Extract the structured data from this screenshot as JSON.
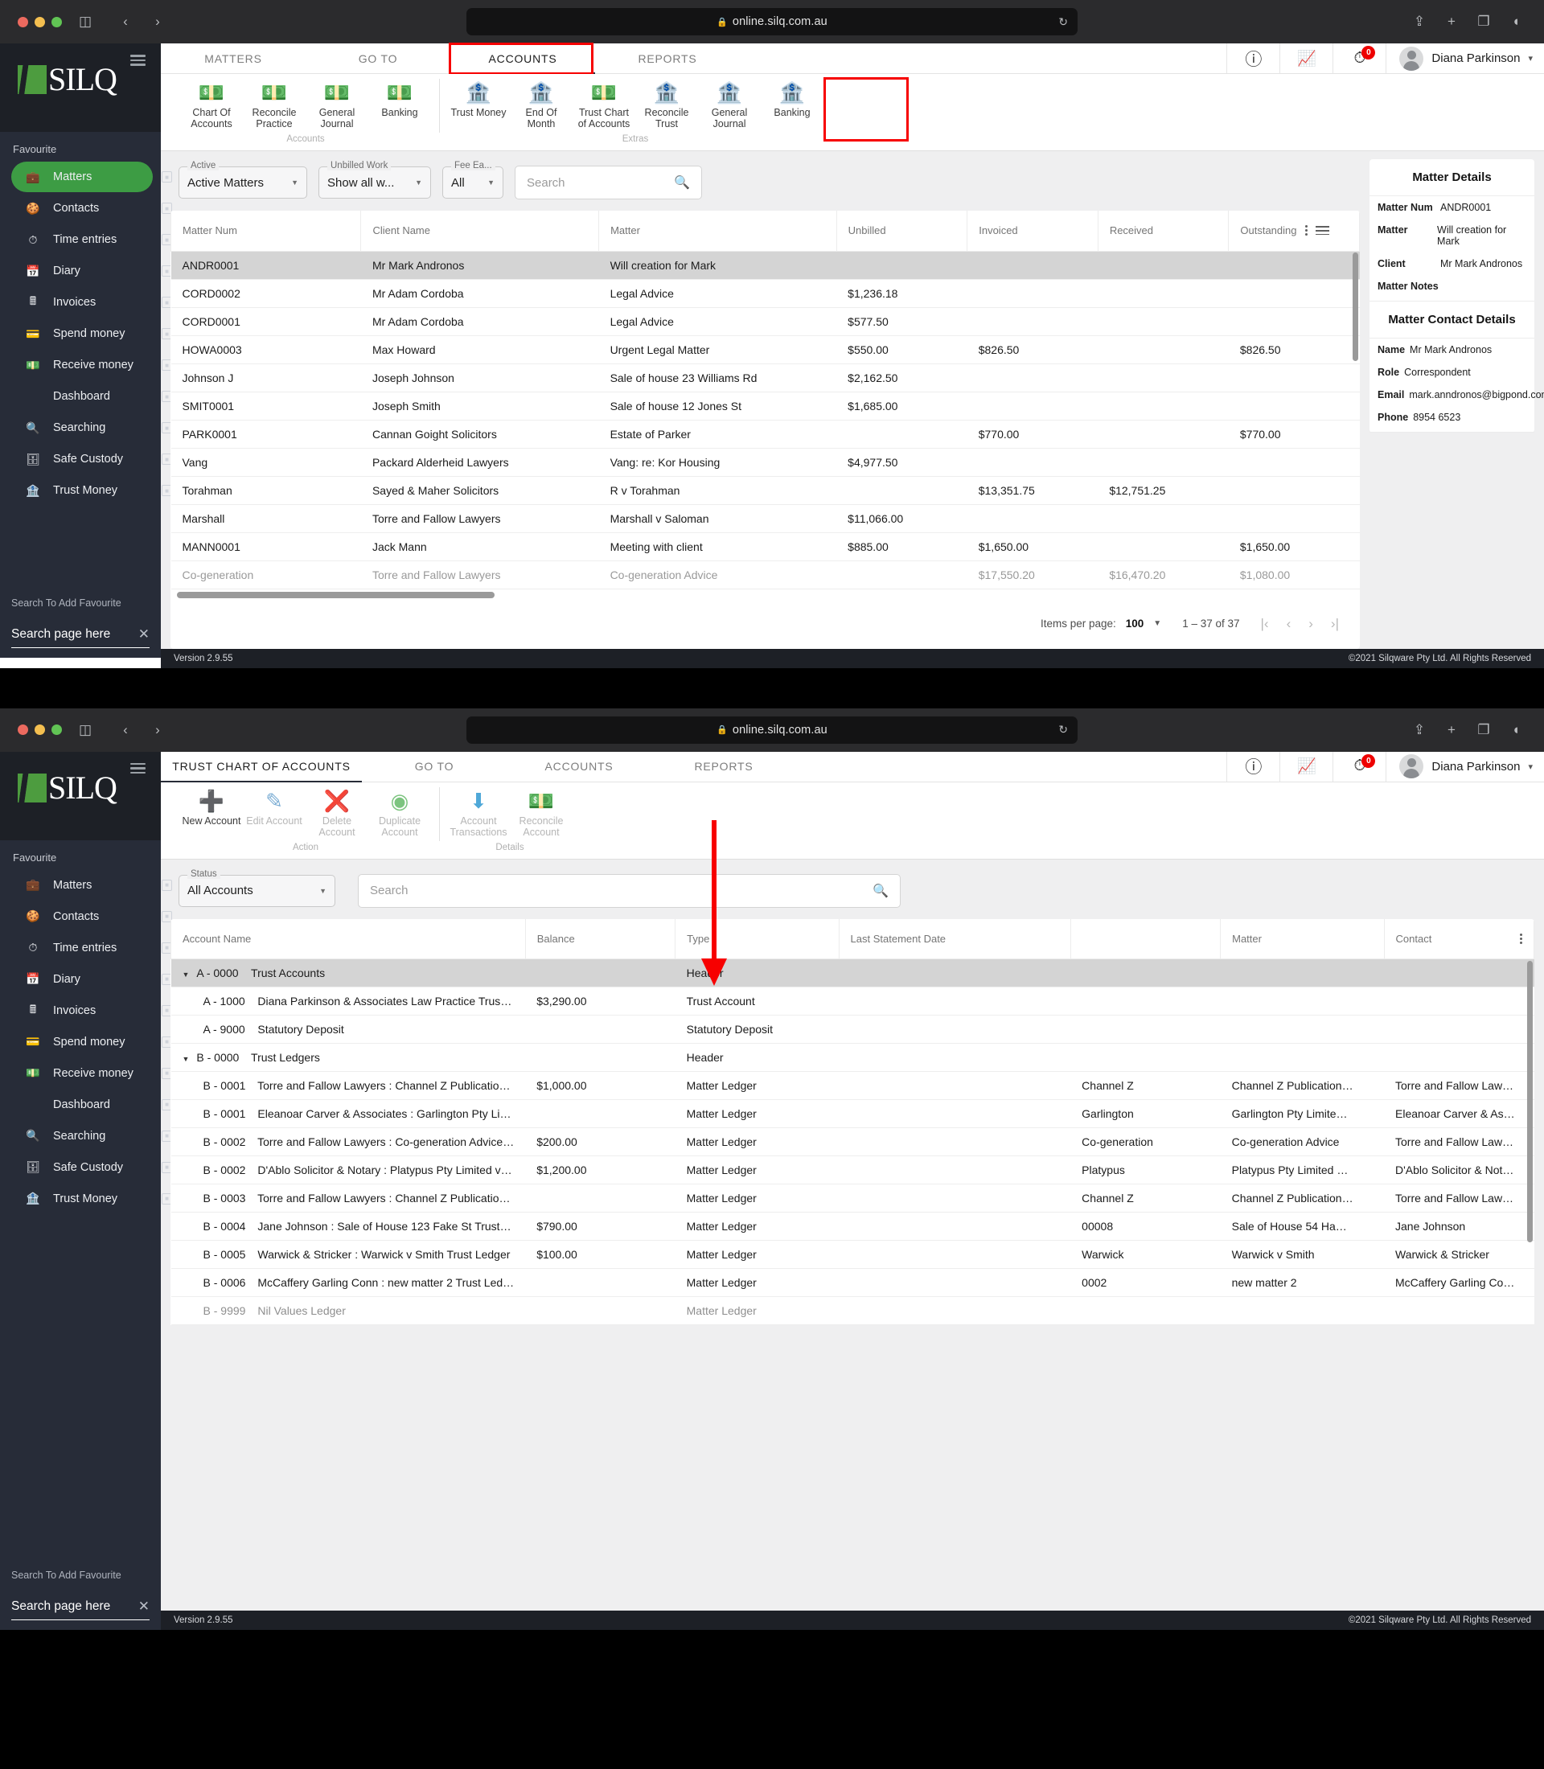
{
  "browser": {
    "url": "online.silq.com.au",
    "lock_icon": "lock-icon",
    "reload_icon": "reload-icon",
    "share_icon": "share-icon",
    "newtab_icon": "plus-icon",
    "tabs_icon": "copy-tabs-icon",
    "sidebar_icon": "sidebar-toggle-icon",
    "back_icon": "back-chevron-icon",
    "forward_icon": "forward-chevron-icon",
    "contrast_icon": "contrast-icon"
  },
  "sidebar": {
    "logo_text": "SILQ",
    "favourite_label": "Favourite",
    "items": [
      {
        "label": "Matters",
        "icon": "briefcase-icon",
        "active": true
      },
      {
        "label": "Contacts",
        "icon": "contacts-icon",
        "active": false
      },
      {
        "label": "Time entries",
        "icon": "stopwatch-icon",
        "active": false
      },
      {
        "label": "Diary",
        "icon": "calendar-icon",
        "active": false
      },
      {
        "label": "Invoices",
        "icon": "calculator-icon",
        "active": false
      },
      {
        "label": "Spend money",
        "icon": "cheque-icon",
        "active": false
      },
      {
        "label": "Receive money",
        "icon": "cash-icon",
        "active": false
      },
      {
        "label": "Dashboard",
        "icon": "",
        "active": false
      },
      {
        "label": "Searching",
        "icon": "magnifier-icon",
        "active": false
      },
      {
        "label": "Safe Custody",
        "icon": "safe-icon",
        "active": false
      },
      {
        "label": "Trust Money",
        "icon": "bank-icon",
        "active": false
      }
    ],
    "add_favourite": "Search To Add Favourite",
    "search_value": "Search page here",
    "clear_icon": "close-icon"
  },
  "topbar": {
    "help_icon": "help-circle-icon",
    "chart_icon": "chart-trend-icon",
    "timer_icon": "stopwatch-icon",
    "timer_badge": "0",
    "avatar_icon": "avatar-icon",
    "user_name": "Diana Parkinson",
    "caret_icon": "chevron-down-icon"
  },
  "highlight_color": "#f70000",
  "window1": {
    "tabs": [
      {
        "label": "MATTERS",
        "active": false,
        "highlighted": false
      },
      {
        "label": "GO TO",
        "active": false,
        "highlighted": false
      },
      {
        "label": "ACCOUNTS",
        "active": true,
        "highlighted": true
      },
      {
        "label": "REPORTS",
        "active": false,
        "highlighted": false
      }
    ],
    "ribbon_groups": [
      {
        "name": "Accounts",
        "items": [
          {
            "label": "Chart Of Accounts",
            "icon": "money-stack-icon",
            "highlighted": false
          },
          {
            "label": "Reconcile Practice",
            "icon": "money-stack-icon",
            "highlighted": false
          },
          {
            "label": "General Journal",
            "icon": "money-stack-icon",
            "highlighted": false
          },
          {
            "label": "Banking",
            "icon": "money-stack-icon",
            "highlighted": false
          }
        ]
      },
      {
        "name": "Extras",
        "items": [
          {
            "label": "Trust Money",
            "icon": "bank-icon",
            "highlighted": false
          },
          {
            "label": "End Of Month",
            "icon": "bank-icon",
            "highlighted": false
          },
          {
            "label": "Trust Chart of Accounts",
            "icon": "money-stack-icon",
            "highlighted": true
          },
          {
            "label": "Reconcile Trust",
            "icon": "bank-icon",
            "highlighted": false
          },
          {
            "label": "General Journal",
            "icon": "bank-icon",
            "highlighted": false
          },
          {
            "label": "Banking",
            "icon": "bank-icon",
            "highlighted": false
          }
        ]
      }
    ],
    "filters": [
      {
        "label": "Active",
        "value": "Active Matters",
        "width": 160
      },
      {
        "label": "Unbilled Work",
        "value": "Show all w...",
        "width": 128
      },
      {
        "label": "Fee Ea...",
        "value": "All",
        "width": 72
      }
    ],
    "search_placeholder": "Search",
    "search_icon": "magnifier-icon",
    "columns": [
      "Matter Num",
      "Client Name",
      "Matter",
      "Unbilled",
      "Invoiced",
      "Received",
      "Outstanding"
    ],
    "rows": [
      {
        "cells": [
          "ANDR0001",
          "Mr Mark Andronos",
          "Will creation for Mark",
          "",
          "",
          "",
          ""
        ],
        "selected": true
      },
      {
        "cells": [
          "CORD0002",
          "Mr Adam Cordoba",
          "Legal Advice",
          "$1,236.18",
          "",
          "",
          ""
        ],
        "selected": false
      },
      {
        "cells": [
          "CORD0001",
          "Mr Adam Cordoba",
          "Legal Advice",
          "$577.50",
          "",
          "",
          ""
        ],
        "selected": false
      },
      {
        "cells": [
          "HOWA0003",
          "Max Howard",
          "Urgent Legal Matter",
          "$550.00",
          "$826.50",
          "",
          "$826.50"
        ],
        "selected": false
      },
      {
        "cells": [
          "Johnson J",
          "Joseph Johnson",
          "Sale of house 23 Williams Rd",
          "$2,162.50",
          "",
          "",
          ""
        ],
        "selected": false
      },
      {
        "cells": [
          "SMIT0001",
          "Joseph Smith",
          "Sale of house 12 Jones St",
          "$1,685.00",
          "",
          "",
          ""
        ],
        "selected": false
      },
      {
        "cells": [
          "PARK0001",
          "Cannan Goight Solicitors",
          "Estate of Parker",
          "",
          "$770.00",
          "",
          "$770.00"
        ],
        "selected": false
      },
      {
        "cells": [
          "Vang",
          "Packard Alderheid Lawyers",
          "Vang: re: Kor Housing",
          "$4,977.50",
          "",
          "",
          ""
        ],
        "selected": false
      },
      {
        "cells": [
          "Torahman",
          "Sayed & Maher Solicitors",
          "R v Torahman",
          "",
          "$13,351.75",
          "$12,751.25",
          ""
        ],
        "selected": false
      },
      {
        "cells": [
          "Marshall",
          "Torre and Fallow Lawyers",
          "Marshall v Saloman",
          "$11,066.00",
          "",
          "",
          ""
        ],
        "selected": false
      },
      {
        "cells": [
          "MANN0001",
          "Jack Mann",
          "Meeting with client",
          "$885.00",
          "$1,650.00",
          "",
          "$1,650.00"
        ],
        "selected": false
      },
      {
        "cells": [
          "Co-generation",
          "Torre and Fallow Lawyers",
          "Co-generation Advice",
          "",
          "$17,550.20",
          "$16,470.20",
          "$1,080.00"
        ],
        "selected": false
      }
    ],
    "paginator": {
      "items_per_page_label": "Items per page:",
      "items_per_page_value": "100",
      "range_label": "1 – 37 of 37",
      "first_icon": "first-page-icon",
      "prev_icon": "prev-page-icon",
      "next_icon": "next-page-icon",
      "last_icon": "last-page-icon"
    },
    "details": {
      "title": "Matter Details",
      "rows": [
        {
          "key": "Matter Num",
          "value": "ANDR0001"
        },
        {
          "key": "Matter",
          "value": "Will creation for Mark"
        },
        {
          "key": "Client",
          "value": "Mr Mark Andronos"
        },
        {
          "key": "Matter Notes",
          "value": ""
        }
      ],
      "contact_title": "Matter Contact Details",
      "contact_rows": [
        {
          "key": "Name",
          "value": "Mr Mark Andronos"
        },
        {
          "key": "Role",
          "value": "Correspondent"
        },
        {
          "key": "Email",
          "value": "mark.anndronos@bigpond.com"
        },
        {
          "key": "Phone",
          "value": "8954 6523"
        }
      ]
    },
    "status": {
      "version": "Version 2.9.55",
      "copyright": "©2021 Silqware Pty Ltd. All Rights Reserved"
    }
  },
  "window2": {
    "tabs": [
      {
        "label": "TRUST CHART OF ACCOUNTS",
        "active": true,
        "highlighted": false
      },
      {
        "label": "GO TO",
        "active": false,
        "highlighted": false
      },
      {
        "label": "ACCOUNTS",
        "active": false,
        "highlighted": false
      },
      {
        "label": "REPORTS",
        "active": false,
        "highlighted": false
      }
    ],
    "ribbon_groups": [
      {
        "name": "Action",
        "items": [
          {
            "label": "New Account",
            "icon": "plus-circle-icon",
            "disabled": false
          },
          {
            "label": "Edit Account",
            "icon": "pencil-circle-icon",
            "disabled": true
          },
          {
            "label": "Delete Account",
            "icon": "delete-circle-icon",
            "disabled": true
          },
          {
            "label": "Duplicate Account",
            "icon": "duplicate-icon",
            "disabled": true
          }
        ]
      },
      {
        "name": "Details",
        "items": [
          {
            "label": "Account Transactions",
            "icon": "down-arrow-icon",
            "disabled": true
          },
          {
            "label": "Reconcile Account",
            "icon": "money-stack-icon",
            "disabled": true
          }
        ]
      }
    ],
    "filters": [
      {
        "label": "Status",
        "value": "All Accounts",
        "width": 195
      }
    ],
    "search_placeholder": "Search",
    "search_icon": "magnifier-icon",
    "columns": [
      "Account Name",
      "Balance",
      "Type",
      "Last Statement Date",
      "",
      "Matter",
      "Contact"
    ],
    "rows": [
      {
        "indent": 0,
        "expander": true,
        "code": "A - 0000",
        "name": "Trust Accounts",
        "balance": "",
        "type": "Header",
        "date": "",
        "blank": "",
        "matter": "",
        "contact": "",
        "selected": true
      },
      {
        "indent": 1,
        "expander": false,
        "code": "A - 1000",
        "name": "Diana Parkinson & Associates Law Practice Trust …",
        "balance": "$3,290.00",
        "type": "Trust Account",
        "date": "",
        "blank": "",
        "matter": "",
        "contact": "",
        "selected": false
      },
      {
        "indent": 1,
        "expander": false,
        "code": "A - 9000",
        "name": "Statutory Deposit",
        "balance": "",
        "type": "Statutory Deposit",
        "date": "",
        "blank": "",
        "matter": "",
        "contact": "",
        "selected": false
      },
      {
        "indent": 0,
        "expander": true,
        "code": "B - 0000",
        "name": "Trust Ledgers",
        "balance": "",
        "type": "Header",
        "date": "",
        "blank": "",
        "matter": "",
        "contact": "",
        "selected": false
      },
      {
        "indent": 1,
        "expander": false,
        "code": "B - 0001",
        "name": "Torre and Fallow Lawyers : Channel Z Publications…",
        "balance": "$1,000.00",
        "type": "Matter Ledger",
        "date": "",
        "blank": "Channel Z",
        "matter": "Channel Z Publication…",
        "contact": "Torre and Fallow Law…",
        "selected": false
      },
      {
        "indent": 1,
        "expander": false,
        "code": "B - 0001",
        "name": "Eleanoar Carver & Associates : Garlington Pty Limi…",
        "balance": "",
        "type": "Matter Ledger",
        "date": "",
        "blank": "Garlington",
        "matter": "Garlington Pty Limite…",
        "contact": "Eleanoar Carver & As…",
        "selected": false
      },
      {
        "indent": 1,
        "expander": false,
        "code": "B - 0002",
        "name": "Torre and Fallow Lawyers : Co-generation Advice …",
        "balance": "$200.00",
        "type": "Matter Ledger",
        "date": "",
        "blank": "Co-generation",
        "matter": "Co-generation Advice",
        "contact": "Torre and Fallow Law…",
        "selected": false
      },
      {
        "indent": 1,
        "expander": false,
        "code": "B - 0002",
        "name": "D'Ablo Solicitor & Notary : Platypus Pty Limited v …",
        "balance": "$1,200.00",
        "type": "Matter Ledger",
        "date": "",
        "blank": "Platypus",
        "matter": "Platypus Pty Limited …",
        "contact": "D'Ablo Solicitor & Not…",
        "selected": false
      },
      {
        "indent": 1,
        "expander": false,
        "code": "B - 0003",
        "name": "Torre and Fallow Lawyers : Channel Z Publications…",
        "balance": "",
        "type": "Matter Ledger",
        "date": "",
        "blank": "Channel Z",
        "matter": "Channel Z Publication…",
        "contact": "Torre and Fallow Law…",
        "selected": false
      },
      {
        "indent": 1,
        "expander": false,
        "code": "B - 0004",
        "name": "Jane Johnson : Sale of House 123 Fake St Trust L…",
        "balance": "$790.00",
        "type": "Matter Ledger",
        "date": "",
        "blank": "00008",
        "matter": "Sale of House 54 Ha…",
        "contact": "Jane Johnson",
        "selected": false
      },
      {
        "indent": 1,
        "expander": false,
        "code": "B - 0005",
        "name": "Warwick & Stricker : Warwick v Smith Trust Ledger",
        "balance": "$100.00",
        "type": "Matter Ledger",
        "date": "",
        "blank": "Warwick",
        "matter": "Warwick v Smith",
        "contact": "Warwick & Stricker",
        "selected": false
      },
      {
        "indent": 1,
        "expander": false,
        "code": "B - 0006",
        "name": "McCaffery Garling Conn : new matter 2 Trust Ledg…",
        "balance": "",
        "type": "Matter Ledger",
        "date": "",
        "blank": "0002",
        "matter": "new matter 2",
        "contact": "McCaffery Garling Co…",
        "selected": false
      },
      {
        "indent": 1,
        "expander": false,
        "code": "B - 9999",
        "name": "Nil Values Ledger",
        "balance": "",
        "type": "Matter Ledger",
        "date": "",
        "blank": "",
        "matter": "",
        "contact": "",
        "selected": false
      }
    ],
    "status": {
      "version": "Version 2.9.55",
      "copyright": "©2021 Silqware Pty Ltd. All Rights Reserved"
    }
  }
}
